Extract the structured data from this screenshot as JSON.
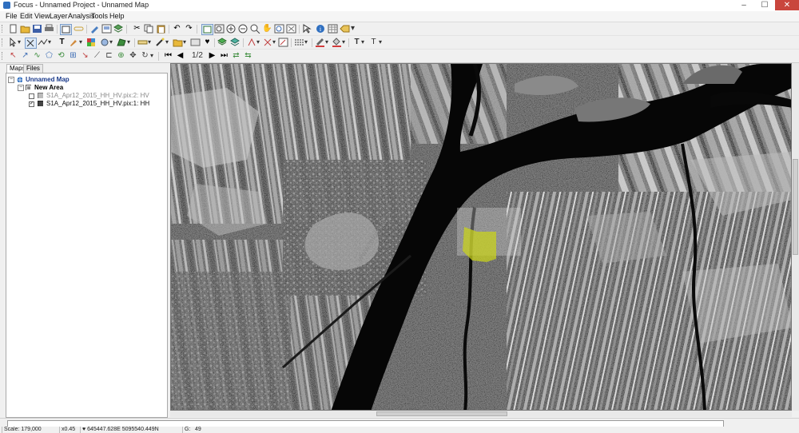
{
  "window": {
    "title": "Focus - Unnamed Project - Unnamed Map",
    "minimize": "–",
    "maximize": "☐",
    "close": "✕"
  },
  "menu": [
    "File",
    "Edit",
    "View",
    "Layer",
    "Analysis",
    "Tools",
    "Help"
  ],
  "toolbar": {
    "zoom_ratio": "1/2"
  },
  "left_panel": {
    "tabs": [
      "Maps",
      "Files"
    ],
    "tree": {
      "map_name": "Unnamed Map",
      "area_name": "New Area",
      "layers": [
        {
          "name": "S1A_Apr12_2015_HH_HV.pix:2: HV",
          "checked": false
        },
        {
          "name": "S1A_Apr12_2015_HH_HV.pix:1: HH",
          "checked": true
        }
      ]
    }
  },
  "map": {
    "highlight_color": "#c8d21e"
  },
  "progress": {
    "fraction": 0.0
  },
  "status": {
    "scale": "Scale: 179,000",
    "zoom": "x0.45",
    "coords": "645447.628E 5095540.449N",
    "value_label": "G:",
    "value": "49"
  },
  "colors": {
    "close_button": "#c9463d",
    "progress_fill": "#3c9b3c"
  }
}
